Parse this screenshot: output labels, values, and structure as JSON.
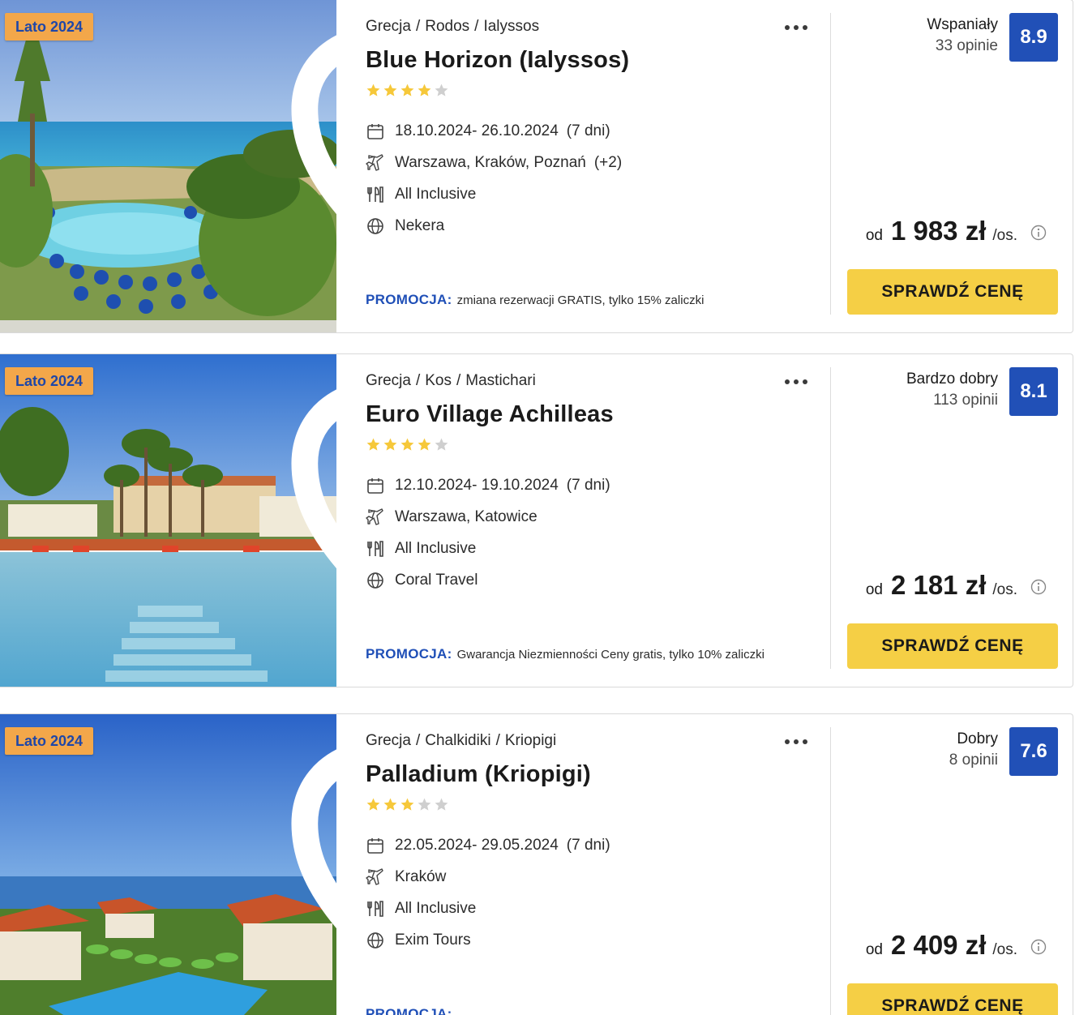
{
  "colors": {
    "badge_bg": "#f3a74a",
    "badge_text": "#1f47a8",
    "score_bg": "#2150b7",
    "promo_label": "#1f4fb7",
    "cta_bg": "#f5cf45",
    "star_filled": "#f6c83a",
    "star_empty": "#cfcfcf"
  },
  "icons": {
    "favorite": "heart-icon",
    "more": "ellipsis-icon",
    "dates": "calendar-icon",
    "departure": "plane-icon",
    "board": "cutlery-icon",
    "operator": "globe-icon",
    "price_info": "info-icon"
  },
  "offers": [
    {
      "badge": "Lato 2024",
      "breadcrumb": [
        "Grecja",
        "Rodos",
        "Ialyssos"
      ],
      "name": "Blue Horizon (Ialyssos)",
      "stars": 4,
      "dates": "18.10.2024- 26.10.2024",
      "duration": "(7 dni)",
      "departure": "Warszawa, Kraków, Poznań",
      "departure_extra": "(+2)",
      "board": "All Inclusive",
      "operator": "Nekera",
      "promo_label": "PROMOCJA:",
      "promo_text": "zmiana rezerwacji GRATIS, tylko 15% zaliczki",
      "rating_word": "Wspaniały",
      "rating_count": "33 opinie",
      "score": "8.9",
      "price_from": "od",
      "price": "1 983 zł",
      "price_per": "/os.",
      "cta": "SPRAWDŹ CENĘ"
    },
    {
      "badge": "Lato 2024",
      "breadcrumb": [
        "Grecja",
        "Kos",
        "Mastichari"
      ],
      "name": "Euro Village Achilleas",
      "stars": 4,
      "dates": "12.10.2024- 19.10.2024",
      "duration": "(7 dni)",
      "departure": "Warszawa, Katowice",
      "departure_extra": "",
      "board": "All Inclusive",
      "operator": "Coral Travel",
      "promo_label": "PROMOCJA:",
      "promo_text": "Gwarancja Niezmienności Ceny gratis, tylko 10% zaliczki",
      "rating_word": "Bardzo dobry",
      "rating_count": "113 opinii",
      "score": "8.1",
      "price_from": "od",
      "price": "2 181 zł",
      "price_per": "/os.",
      "cta": "SPRAWDŹ CENĘ"
    },
    {
      "badge": "Lato 2024",
      "breadcrumb": [
        "Grecja",
        "Chalkidiki",
        "Kriopigi"
      ],
      "name": "Palladium (Kriopigi)",
      "stars": 3,
      "dates": "22.05.2024- 29.05.2024",
      "duration": "(7 dni)",
      "departure": "Kraków",
      "departure_extra": "",
      "board": "All Inclusive",
      "operator": "Exim Tours",
      "promo_label": "PROMOCJA:",
      "promo_text": "",
      "rating_word": "Dobry",
      "rating_count": "8 opinii",
      "score": "7.6",
      "price_from": "od",
      "price": "2 409 zł",
      "price_per": "/os.",
      "cta": "SPRAWDŹ CENĘ"
    }
  ]
}
